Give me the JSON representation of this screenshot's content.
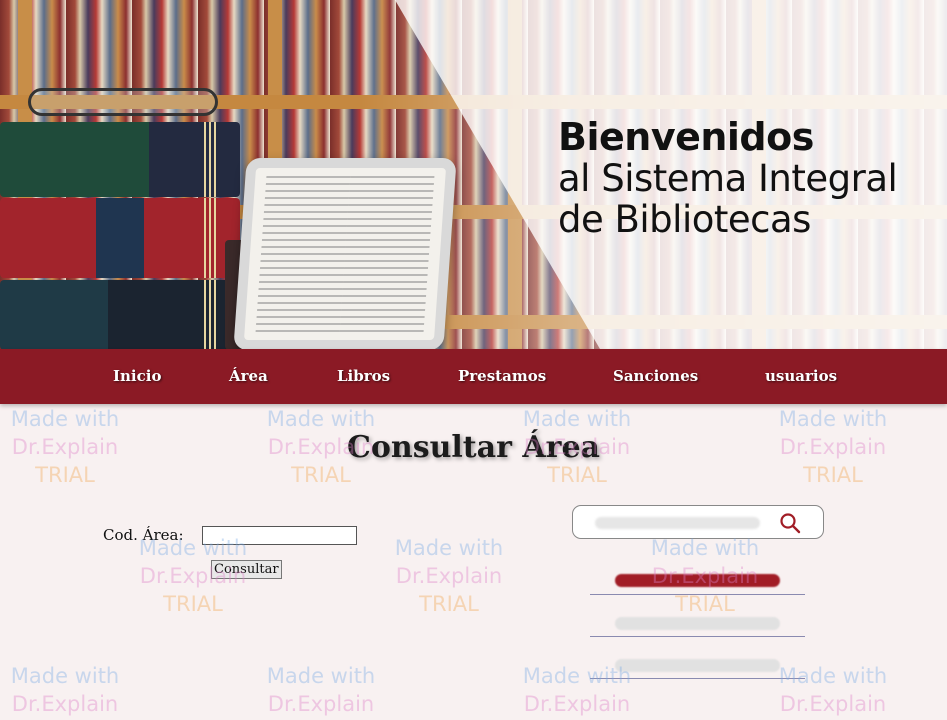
{
  "banner": {
    "welcome_line1": "Bienvenidos",
    "welcome_line2": "al Sistema Integral",
    "welcome_line3": "de Bibliotecas"
  },
  "nav": {
    "items": [
      "Inicio",
      "Área",
      "Libros",
      "Prestamos",
      "Sanciones",
      "usuarios"
    ],
    "background": "#8b1a25"
  },
  "main": {
    "title": "Consultar Área",
    "form": {
      "label": "Cod. Área:",
      "input_value": "",
      "button_label": "Consultar"
    }
  },
  "sidebar": {
    "search_icon": "search-icon",
    "accent": "#a11d26"
  },
  "watermark": {
    "line1": "Made with",
    "line2": "Dr.Explain",
    "line3": "TRIAL"
  }
}
